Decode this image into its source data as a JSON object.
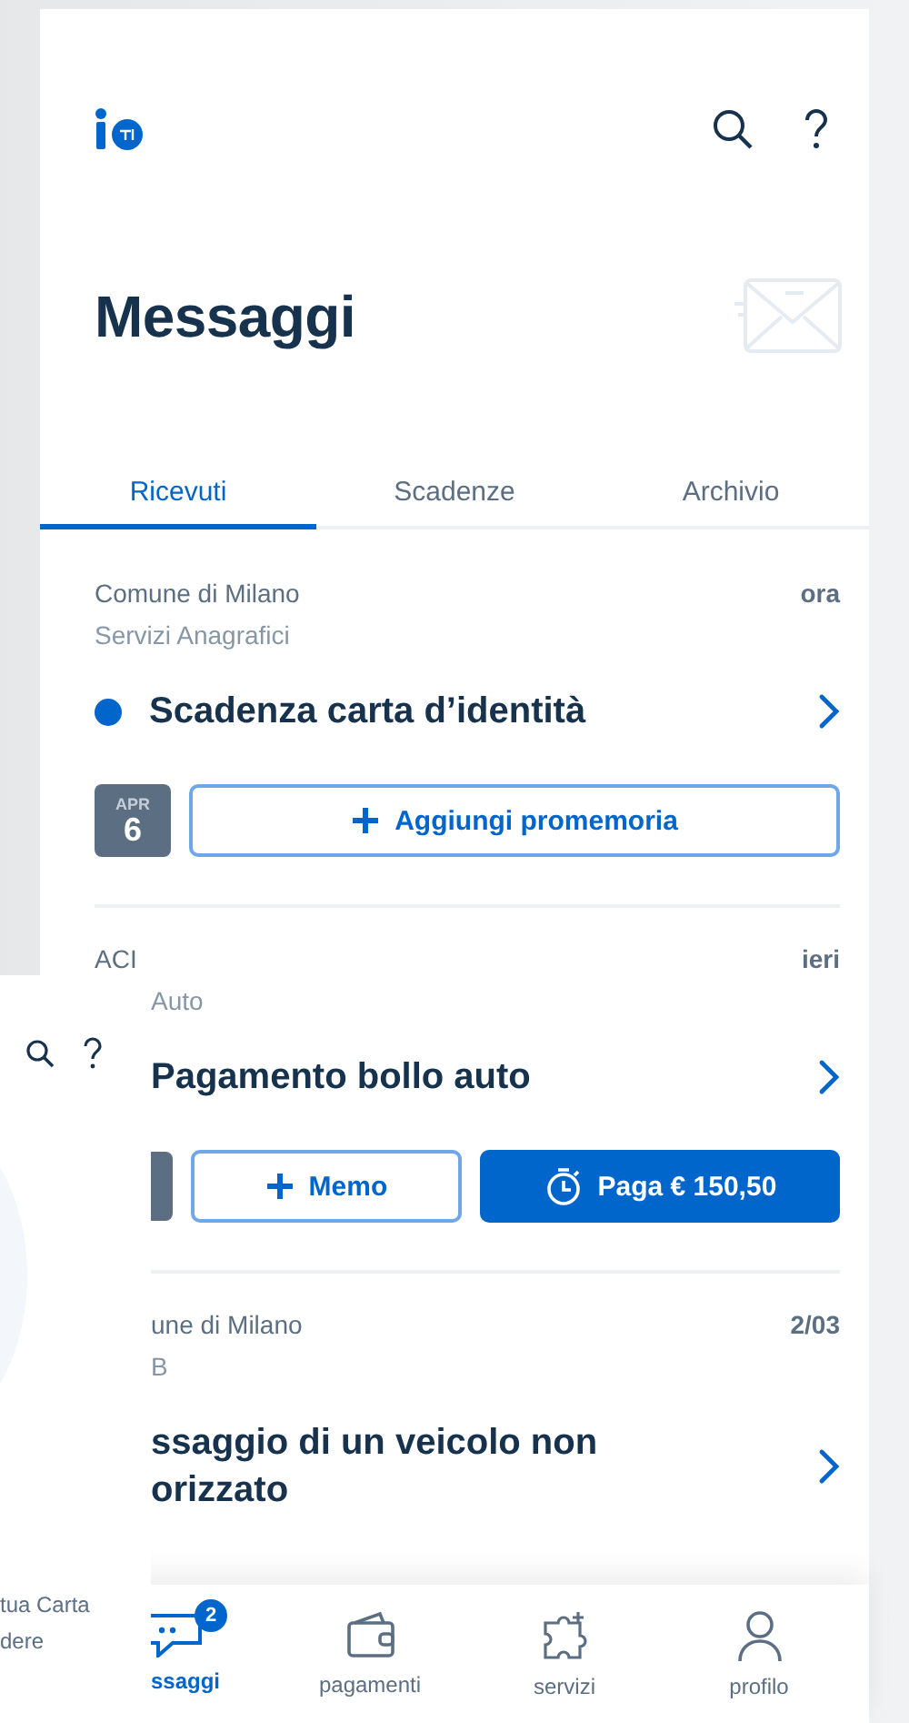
{
  "header": {
    "title": "Messaggi"
  },
  "tabs": [
    {
      "label": "Ricevuti",
      "selected": true
    },
    {
      "label": "Scadenze",
      "selected": false
    },
    {
      "label": "Archivio",
      "selected": false
    }
  ],
  "messages": [
    {
      "sender": "Comune di Milano",
      "service": "Servizi Anagrafici",
      "time": "ora",
      "title_lines": [
        "Scadenza carta d’identità"
      ],
      "unread": true,
      "calendar": {
        "month": "APR",
        "day": "6"
      },
      "actions": [
        {
          "kind": "outline",
          "label": "Aggiungi promemoria"
        }
      ]
    },
    {
      "sender": "ACI",
      "service": "Auto",
      "time": "ieri",
      "title_lines": [
        "Pagamento bollo auto"
      ],
      "unread": false,
      "actions": [
        {
          "kind": "outline",
          "label": "Memo"
        },
        {
          "kind": "primary",
          "label": "Paga € 150,50"
        }
      ]
    },
    {
      "sender": "une di Milano",
      "service": "B",
      "time": "2/03",
      "title_lines": [
        "ssaggio di un veicolo non",
        "orizzato"
      ],
      "unread": false
    }
  ],
  "bottom_nav": [
    {
      "label": "ssaggi",
      "selected": true,
      "badge": "2"
    },
    {
      "label": "pagamenti",
      "selected": false
    },
    {
      "label": "servizi",
      "selected": false
    },
    {
      "label": "profilo",
      "selected": false
    }
  ],
  "overlay_screen": {
    "text_lines": [
      "tua Carta",
      "dere"
    ]
  }
}
